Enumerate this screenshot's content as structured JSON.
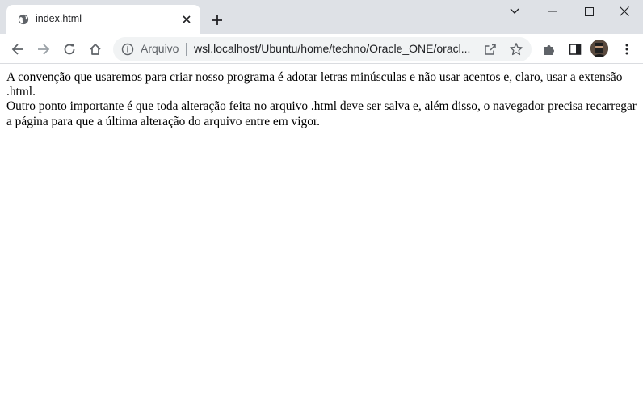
{
  "tab": {
    "title": "index.html"
  },
  "omnibox": {
    "security_label": "Arquivo",
    "url": "wsl.localhost/Ubuntu/home/techno/Oracle_ONE/oracl..."
  },
  "page": {
    "paragraph1": "A convenção que usaremos para criar nosso programa é adotar letras minúsculas e não usar acentos e, claro, usar a extensão .html.",
    "paragraph2": "Outro ponto importante é que toda alteração feita no arquivo .html deve ser salva e, além disso, o navegador precisa recarregar a página para que a última alteração do arquivo entre em vigor."
  }
}
